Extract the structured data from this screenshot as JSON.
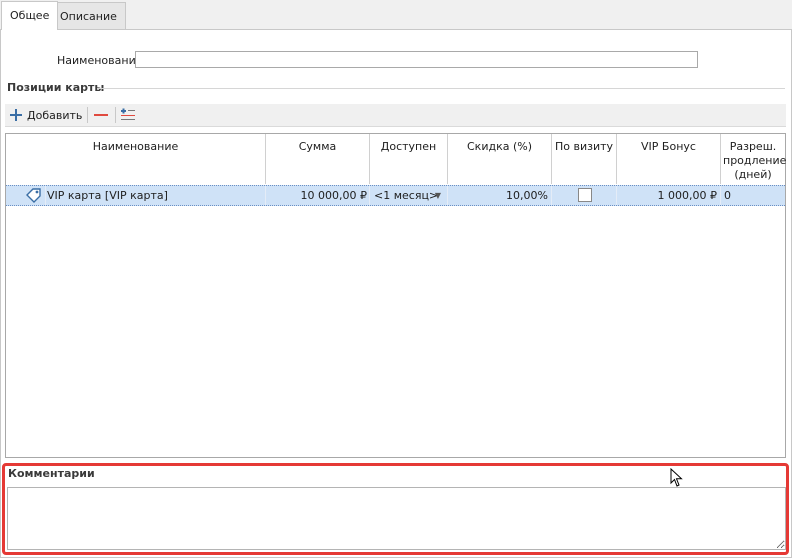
{
  "tabs": [
    {
      "label": "Общее"
    },
    {
      "label": "Описание"
    }
  ],
  "form": {
    "name_label": "Наименование:",
    "name_value": ""
  },
  "positions": {
    "title": "Позиции карты",
    "toolbar": {
      "add_label": "Добавить"
    },
    "columns": [
      {
        "label": "Наименование"
      },
      {
        "label": "Сумма"
      },
      {
        "label": "Доступен"
      },
      {
        "label": "Скидка (%)"
      },
      {
        "label": "По визиту"
      },
      {
        "label": "VIP Бонус"
      },
      {
        "label": "Разреш. продление (дней)"
      }
    ],
    "rows": [
      {
        "name": "VIP карта [VIP карта]",
        "sum": "10 000,00 ₽",
        "available": "<1 месяц>",
        "discount": "10,00%",
        "per_visit": false,
        "vip_bonus": "1 000,00 ₽",
        "extension_days": "0"
      }
    ]
  },
  "comments": {
    "title": "Комментарии",
    "value": ""
  },
  "colors": {
    "highlight": "#e53935",
    "selected_row": "#cfe2f7"
  }
}
